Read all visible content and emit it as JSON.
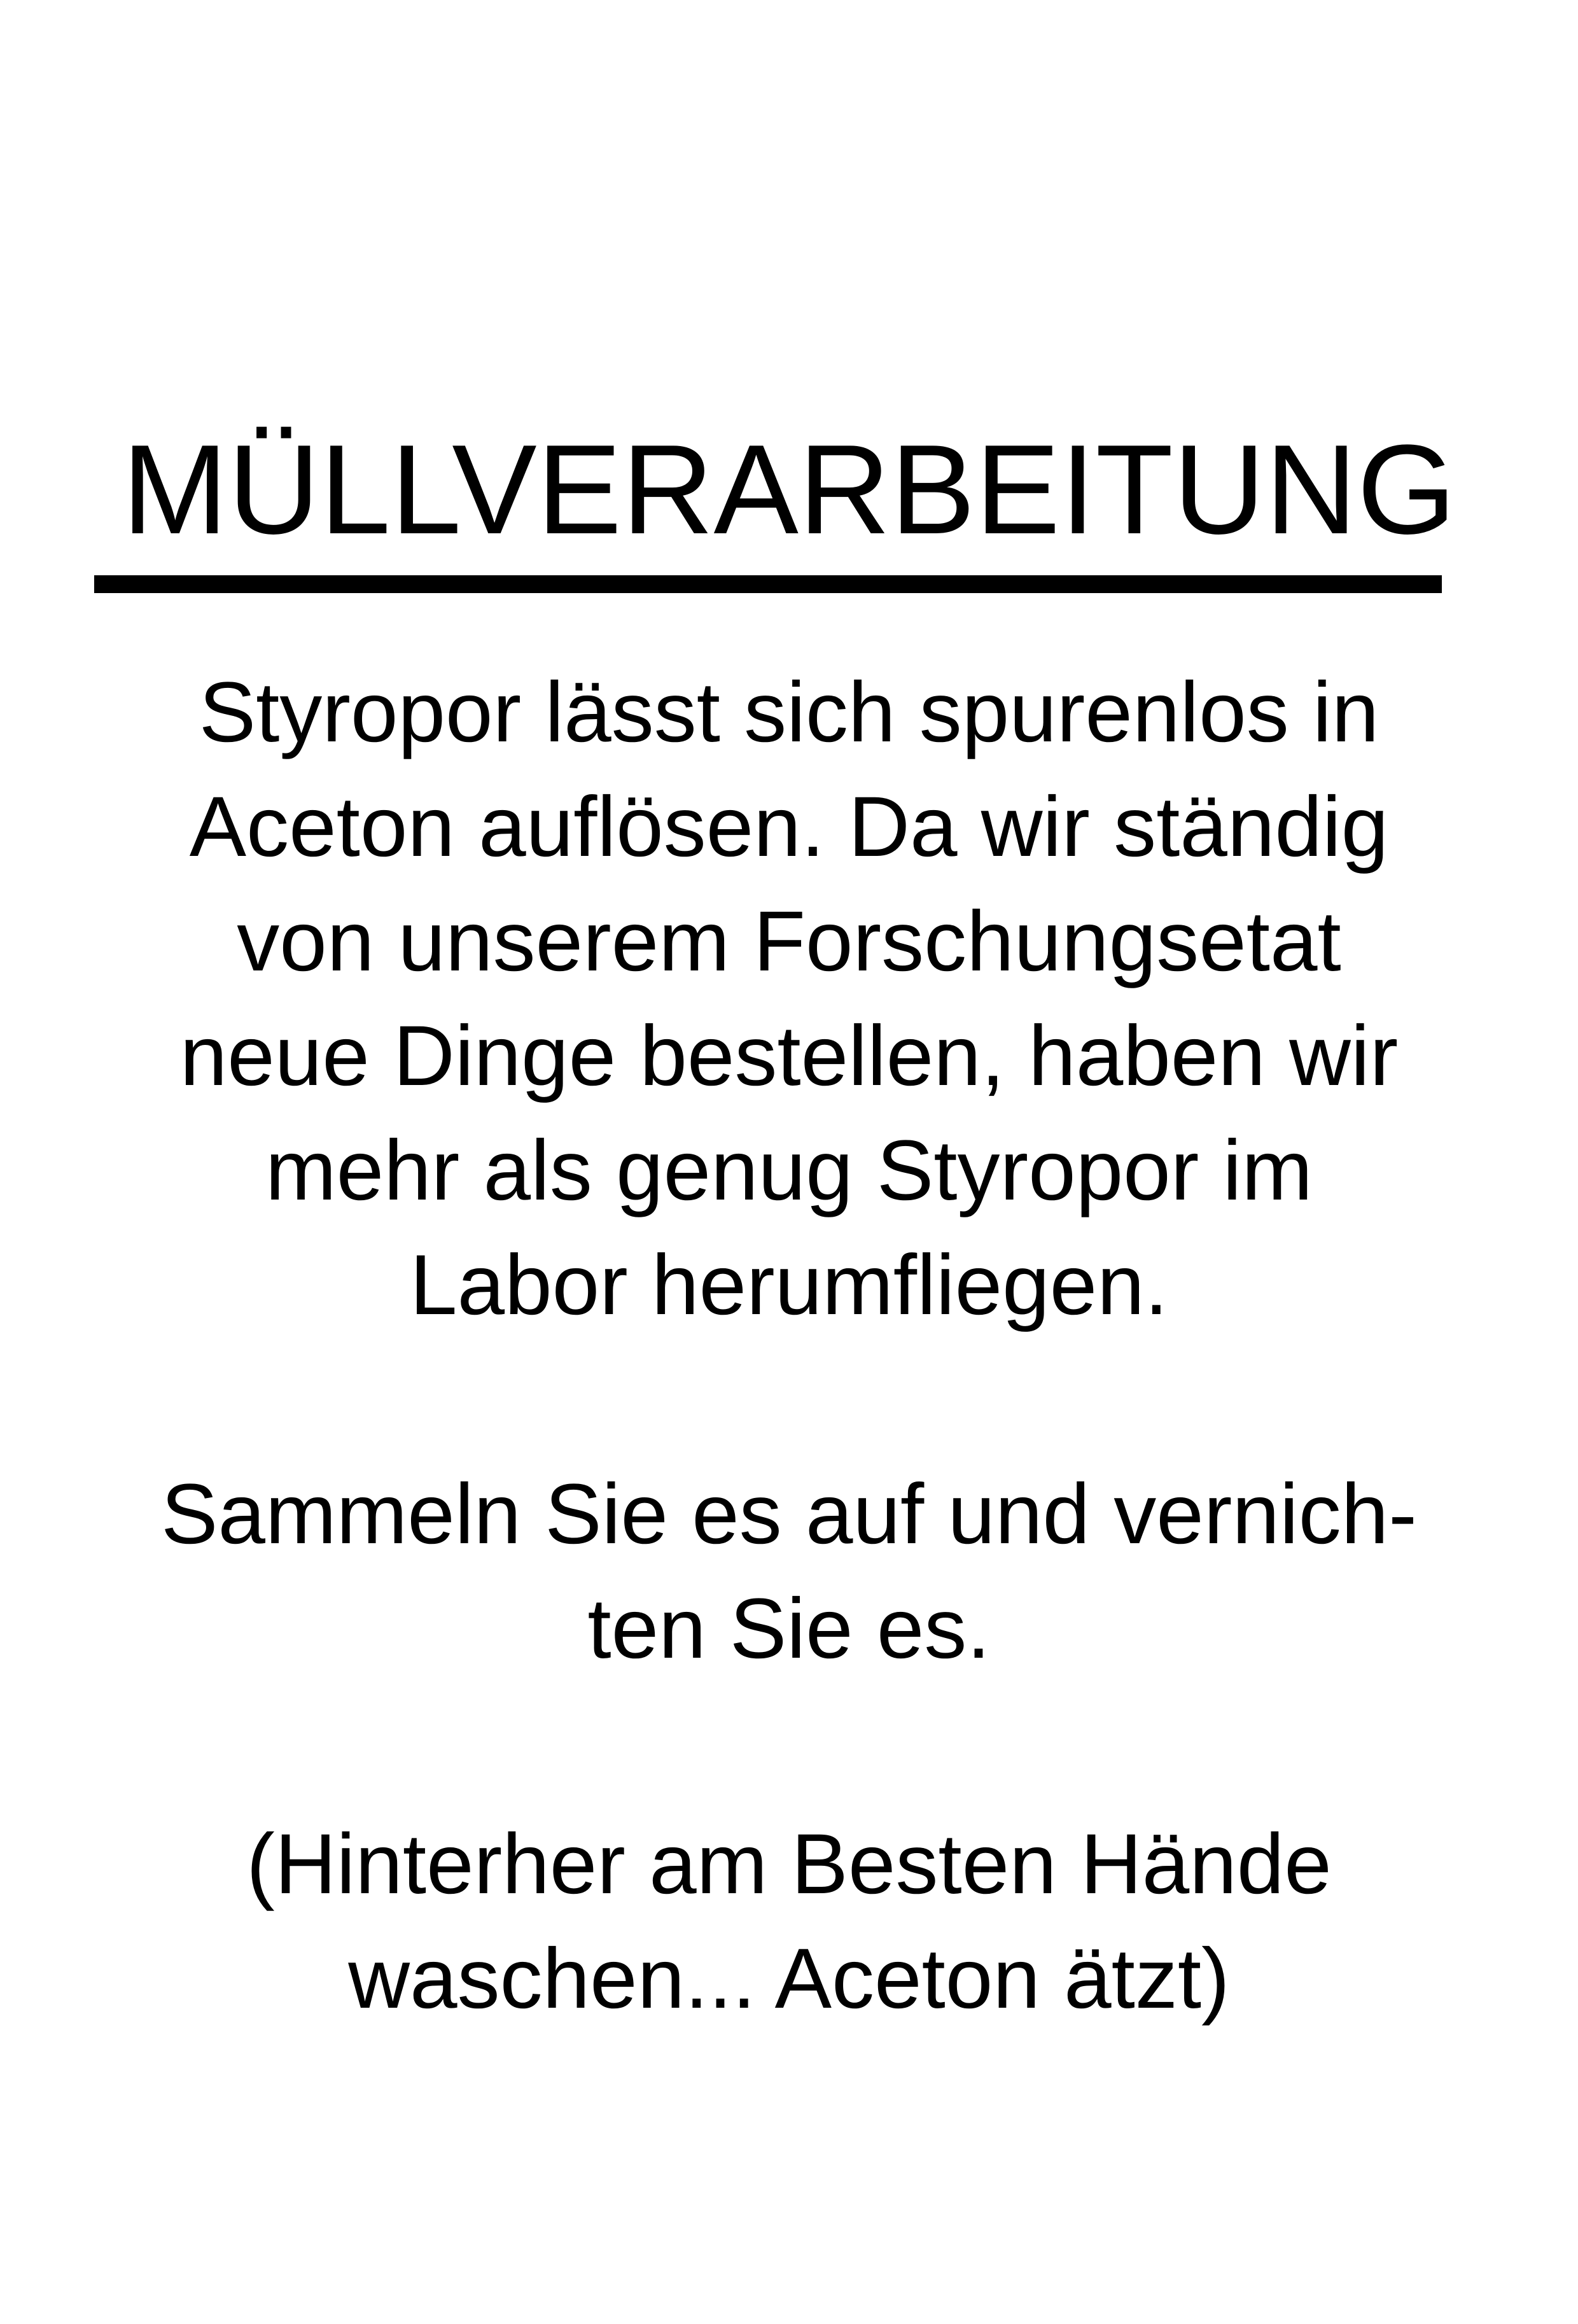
{
  "title": "MÜLLVERARBEITUNG",
  "paragraphs": [
    {
      "lines": [
        "Styropor lässt sich spurenlos in",
        "Aceton auflösen. Da wir ständig",
        "von unserem Forschungsetat",
        "neue Dinge bestellen, haben wir",
        "mehr als genug Styropor im",
        "Labor herumfliegen."
      ]
    },
    {
      "lines": [
        "Sammeln Sie es auf und vernich-",
        "ten Sie es."
      ]
    },
    {
      "lines": [
        "(Hinterher am Besten Hände",
        "waschen... Aceton ätzt)"
      ]
    }
  ]
}
